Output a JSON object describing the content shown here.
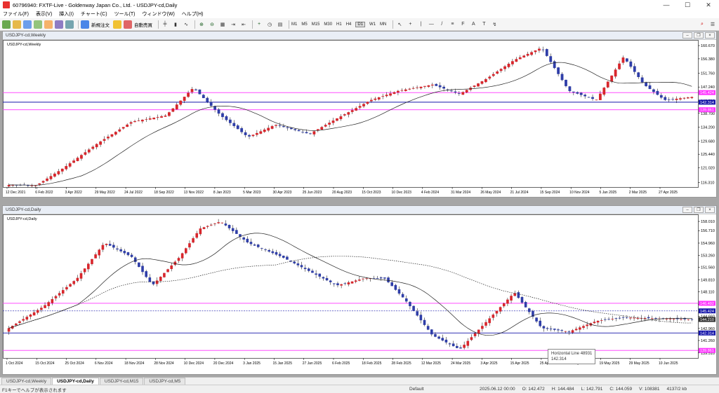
{
  "window": {
    "title": "60796940: FXTF-Live - Goldenway Japan Co., Ltd. - USDJPY-cd,Daily"
  },
  "menu": [
    "ファイル(F)",
    "表示(V)",
    "挿入(I)",
    "チャート(C)",
    "ツール(T)",
    "ウィンドウ(W)",
    "ヘルプ(H)"
  ],
  "toolbar": {
    "new_order": "新規注文",
    "auto_trade": "自動売買",
    "timeframes": [
      "M1",
      "M5",
      "M15",
      "M30",
      "H1",
      "H4",
      "D1",
      "W1",
      "MN"
    ]
  },
  "colors": {
    "bull": "#d8262c",
    "bear": "#2f3ea8",
    "magenta": "#ff33ff",
    "hline_blue": "#1616aa",
    "ma": "#222222",
    "orange": "#f29a2e"
  },
  "weekly": {
    "window_title": "USDJPY-cd,Weekly",
    "label": "USDJPY-cd,Weekly",
    "price_labels": [
      "160.670",
      "156.380",
      "151.760",
      "147.240",
      "142.700",
      "138.700",
      "134.200",
      "129.680",
      "125.440",
      "121.020",
      "116.310"
    ],
    "highlight_labels": [
      {
        "text": "145.424",
        "bg": "#ff33ff"
      },
      {
        "text": "142.314",
        "bg": "#1616aa"
      },
      {
        "text": "139.861",
        "bg": "#ff33ff"
      }
    ],
    "dates": [
      "12 Dec 2021",
      "6 Feb 2022",
      "3 Apr 2022",
      "29 May 2022",
      "24 Jul 2022",
      "18 Sep 2022",
      "13 Nov 2022",
      "8 Jan 2023",
      "5 Mar 2023",
      "30 Apr 2023",
      "25 Jun 2023",
      "20 Aug 2023",
      "15 Oct 2023",
      "10 Dec 2023",
      "4 Feb 2024",
      "31 Mar 2024",
      "26 May 2024",
      "21 Jul 2024",
      "15 Sep 2024",
      "10 Nov 2024",
      "5 Jan 2025",
      "2 Mar 2025",
      "27 Apr 2025"
    ]
  },
  "daily": {
    "window_title": "USDJPY-cd,Daily",
    "label": "USDJPY-cd,Daily",
    "price_labels": [
      "158.010",
      "156.710",
      "154.960",
      "153.260",
      "151.560",
      "149.810",
      "148.110",
      "146.360",
      "144.660",
      "142.960",
      "141.260",
      "139.510"
    ],
    "highlight_labels": [
      {
        "text": "146.492",
        "bg": "#ff33ff"
      },
      {
        "text": "145.424",
        "bg": "#1616aa"
      },
      {
        "text": "144.210",
        "bg": "#333333"
      },
      {
        "text": "142.314",
        "bg": "#1616aa"
      },
      {
        "text": "139.861",
        "bg": "#ff33ff"
      }
    ],
    "dates": [
      "1 Oct 2024",
      "15 Oct 2024",
      "25 Oct 2024",
      "6 Nov 2024",
      "18 Nov 2024",
      "28 Nov 2024",
      "10 Dec 2024",
      "20 Dec 2024",
      "3 Jan 2025",
      "15 Jan 2025",
      "27 Jan 2025",
      "6 Feb 2025",
      "18 Feb 2025",
      "28 Feb 2025",
      "12 Mar 2025",
      "24 Mar 2025",
      "3 Apr 2025",
      "15 Apr 2025",
      "25 Apr 2025",
      "7 May 2025",
      "19 May 2025",
      "29 May 2025",
      "10 Jun 2025"
    ],
    "tooltip": {
      "line1": "Horizontal Line 48931",
      "line2": "142.314"
    }
  },
  "tabs": [
    "USDJPY-cd,Weekly",
    "USDJPY-cd,Daily",
    "USDJPY-cd,M15",
    "USDJPY-cd,M5"
  ],
  "active_tab": 1,
  "status": {
    "help": "F1キーでヘルプが表示されます",
    "profile": "Default",
    "datetime": "2025.06.12 00:00",
    "o": "O: 142.472",
    "h": "H: 144.484",
    "l": "L: 142.791",
    "c": "C: 144.059",
    "v": "V: 108381",
    "kb": "4137/2 kb"
  }
}
